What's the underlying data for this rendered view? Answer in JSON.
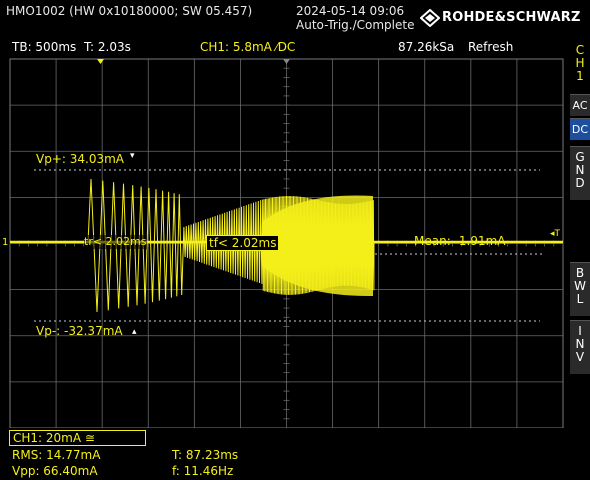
{
  "header": {
    "device": "HMO1002 (HW 0x10180000; SW 05.457)",
    "datetime": "2024-05-14 09:06",
    "status": "Auto-Trig./Complete",
    "brand": "ROHDE&SCHWARZ"
  },
  "topbar": {
    "timebase": "TB: 500ms",
    "trigger_time": "T: 2.03s",
    "channel": "CH1: 5.8mA ⁄DC",
    "sample_rate": "87.26kSa",
    "mode": "Refresh"
  },
  "side_buttons": {
    "ch1": [
      "C",
      "H",
      "1"
    ],
    "ac": "AC",
    "dc": "DC",
    "gnd": [
      "G",
      "N",
      "D"
    ],
    "bwl": [
      "B",
      "W",
      "L"
    ],
    "inv": [
      "I",
      "N",
      "V"
    ]
  },
  "cursors": {
    "vp_plus": "Vp+: 34.03mA",
    "vp_minus": "Vp-: -32.37mA",
    "rise": "tr< 2.02ms",
    "fall": "tf< 2.02ms",
    "mean": "Mean: -1.91mA",
    "ch_marker": "1",
    "trig_marker": "◂T"
  },
  "measurements": {
    "ch1_scale": "CH1: 20mA ≅",
    "rms": "RMS: 14.77mA",
    "vpp": "Vpp: 66.40mA",
    "period": "T: 87.23ms",
    "freq": "f: 11.46Hz"
  },
  "colors": {
    "trace": "#f5ef1a",
    "grid": "#6a6a6a",
    "background": "#000000"
  }
}
